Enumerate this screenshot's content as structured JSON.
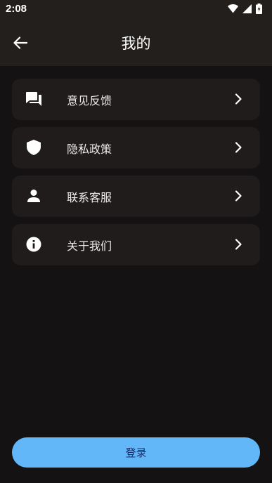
{
  "status_bar": {
    "time": "2:08"
  },
  "header": {
    "title": "我的"
  },
  "menu": {
    "items": [
      {
        "label": "意见反馈",
        "icon": "feedback-icon"
      },
      {
        "label": "隐私政策",
        "icon": "shield-icon"
      },
      {
        "label": "联系客服",
        "icon": "person-icon"
      },
      {
        "label": "关于我们",
        "icon": "info-icon"
      }
    ]
  },
  "login": {
    "label": "登录"
  },
  "colors": {
    "accent": "#62b7f8",
    "card": "#1f1c1b",
    "background": "#141212"
  }
}
